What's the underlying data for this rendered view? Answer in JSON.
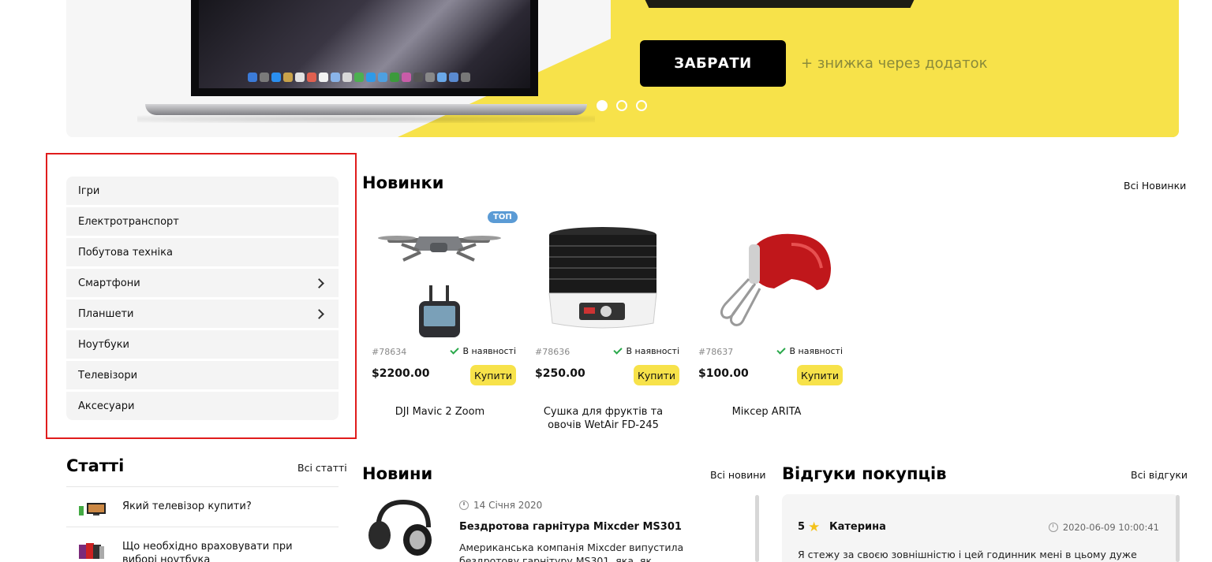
{
  "hero": {
    "button_label": "ЗАБРАТИ",
    "subtext": "+ знижка через додаток",
    "slides": 3,
    "active_slide": 1
  },
  "categories": [
    {
      "label": "Ігри",
      "has_submenu": false
    },
    {
      "label": "Електротранспорт",
      "has_submenu": false
    },
    {
      "label": "Побутова техніка",
      "has_submenu": false
    },
    {
      "label": "Смартфони",
      "has_submenu": true
    },
    {
      "label": "Планшети",
      "has_submenu": true
    },
    {
      "label": "Ноутбуки",
      "has_submenu": false
    },
    {
      "label": "Телевізори",
      "has_submenu": false
    },
    {
      "label": "Аксесуари",
      "has_submenu": false
    }
  ],
  "new_products": {
    "title": "Новинки",
    "all_link": "Всі Новинки",
    "items": [
      {
        "sku": "#78634",
        "stock": "В наявності",
        "price": "$2200.00",
        "buy": "Купити",
        "name": "DJI Mavic 2 Zoom",
        "badge": "ТОП",
        "icon": "drone-image"
      },
      {
        "sku": "#78636",
        "stock": "В наявності",
        "price": "$250.00",
        "buy": "Купити",
        "name": "Сушка для фруктів та овочів WetAir FD-245",
        "badge": "",
        "icon": "dehydrator-image"
      },
      {
        "sku": "#78637",
        "stock": "В наявності",
        "price": "$100.00",
        "buy": "Купити",
        "name": "Міксер ARITA",
        "badge": "",
        "icon": "mixer-image"
      }
    ]
  },
  "articles": {
    "title": "Статті",
    "all_link": "Всі статті",
    "items": [
      {
        "title": "Який телевізор купити?",
        "icon": "tv-thumbnail"
      },
      {
        "title": "Що необхідно враховувати при виборі ноутбука",
        "icon": "laptops-thumbnail"
      }
    ]
  },
  "news": {
    "title": "Новини",
    "all_link": "Всі новини",
    "items": [
      {
        "date": "14 Січня 2020",
        "title": "Бездротова гарнітура Mixcder MS301",
        "body": "Американська компанія Mixcder випустила бездротову гарнітуру MS301, яка, як стверджується, забезпечує високу"
      }
    ]
  },
  "reviews": {
    "title": "Відгуки покупців",
    "all_link": "Всі відгуки",
    "items": [
      {
        "rating": "5",
        "name": "Катерина",
        "date": "2020-06-09 10:00:41",
        "text": "Я стежу за своєю зовнішністю і цей годинник мені в цьому дуже допомагають."
      }
    ]
  },
  "colors": {
    "accent_yellow": "#f7e24a",
    "highlight_red": "#e01c1c",
    "badge_blue": "#5b9bd5",
    "stock_green": "#29a84a"
  }
}
